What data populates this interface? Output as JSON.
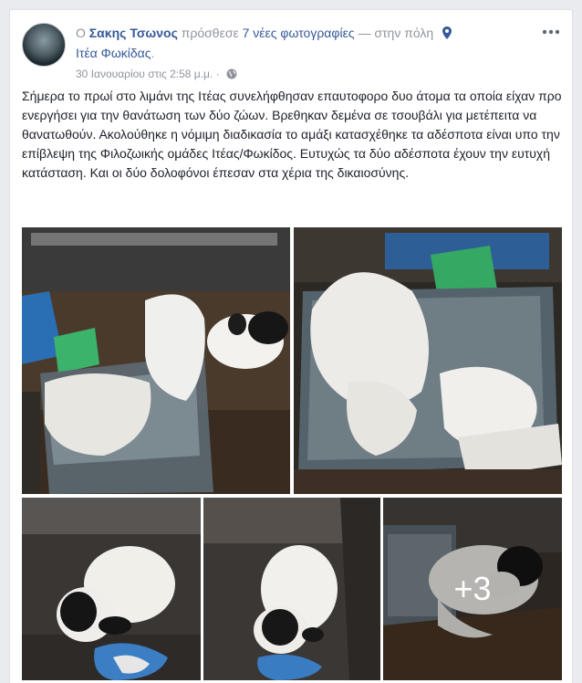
{
  "post": {
    "author": "Σακης Τσωνος",
    "prefix": "Ο",
    "action": "πρόσθεσε",
    "photos_count_text": "7 νέες φωτογραφίες",
    "location_connector": "— στην πόλη",
    "location": "Ιτέα Φωκίδας",
    "location_suffix": ".",
    "timestamp": "30 Ιανουαρίου στις 2:58 μ.μ.",
    "separator": "·",
    "privacy_icon": "globe-icon",
    "body": "Σήμερα το πρωί στο λιμάνι της Ιτέας συνελήφθησαν επαυτοφορο δυο άτομα τα οποία είχαν προ ενεργήσει για την θανάτωση των δύο ζώων. Βρεθηκαν δεμένα σε τσουβάλι για μετέπειτα να θανατωθούν. Ακολούθηκε η νόμιμη διαδικασία το αμάξι κατασχέθηκε τα αδέσποτα είναι υπο την επίβλεψη της Φιλοζωικής ομάδες Ιτέας/Φωκίδος. Ευτυχώς τα δύο αδέσποτα έχουν την ευτυχή κατάσταση. Και οι δύο δολοφόνοι έπεσαν στα χέρια της δικαιοσύνης.",
    "more_photos_label": "+3"
  },
  "icons": {
    "more": "more-options-icon",
    "location": "location-pin-icon"
  },
  "colors": {
    "link": "#365899",
    "meta": "#90949c",
    "text": "#1d2129",
    "background": "#e9ebee"
  }
}
